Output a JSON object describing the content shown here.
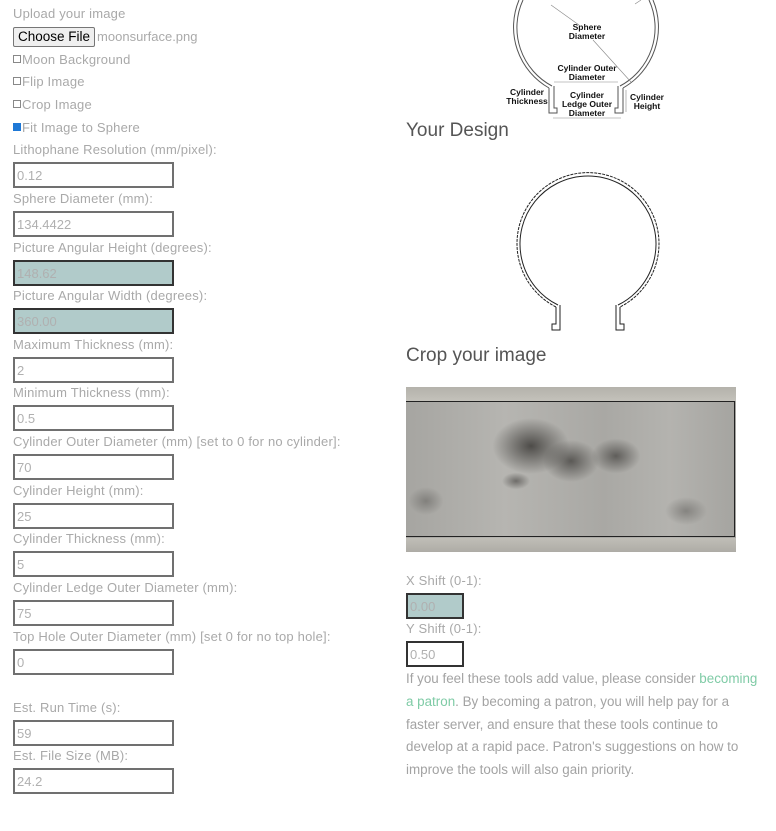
{
  "upload": {
    "label": "Upload your image",
    "button_label": "Choose File",
    "file_name": "moonsurface.png"
  },
  "options": [
    {
      "label": "Moon Background",
      "checked": false
    },
    {
      "label": "Flip Image",
      "checked": false
    },
    {
      "label": "Crop Image",
      "checked": false
    },
    {
      "label": "Fit Image to Sphere",
      "checked": true
    }
  ],
  "fields": [
    {
      "label": "Lithophane Resolution (mm/pixel):",
      "value": "0.12",
      "readonly": false
    },
    {
      "label": "Sphere Diameter (mm):",
      "value": "134.4422",
      "readonly": false
    },
    {
      "label": "Picture Angular Height (degrees):",
      "value": "148.62",
      "readonly": true
    },
    {
      "label": "Picture Angular Width (degrees):",
      "value": "360.00",
      "readonly": true
    },
    {
      "label": "Maximum Thickness (mm):",
      "value": "2",
      "readonly": false
    },
    {
      "label": "Minimum Thickness (mm):",
      "value": "0.5",
      "readonly": false
    },
    {
      "label": "Cylinder Outer Diameter (mm) [set to 0 for no cylinder]:",
      "value": "70",
      "readonly": false
    },
    {
      "label": "Cylinder Height (mm):",
      "value": "25",
      "readonly": false
    },
    {
      "label": "Cylinder Thickness (mm):",
      "value": "5",
      "readonly": false
    },
    {
      "label": "Cylinder Ledge Outer Diameter (mm):",
      "value": "75",
      "readonly": false
    },
    {
      "label": "Top Hole Outer Diameter (mm) [set 0 for no top hole]:",
      "value": "0",
      "readonly": false
    }
  ],
  "estimates": [
    {
      "label": "Est. Run Time (s):",
      "value": "59"
    },
    {
      "label": "Est. File Size (MB):",
      "value": "24.2"
    }
  ],
  "diagram": {
    "labels": {
      "sphere_diameter": [
        "Sphere",
        "Diameter"
      ],
      "cylinder_outer_diameter": [
        "Cylinder Outer",
        "Diameter"
      ],
      "cylinder_thickness": [
        "Cylinder",
        "Thickness"
      ],
      "cylinder_ledge": [
        "Cylinder",
        "Ledge Outer",
        "Diameter"
      ],
      "cylinder_height": [
        "Cylinder",
        "Height"
      ]
    }
  },
  "design": {
    "title": "Your Design"
  },
  "crop": {
    "title": "Crop your image",
    "x_shift_label": "X Shift (0-1):",
    "x_shift_value": "0.00",
    "y_shift_label": "Y Shift (0-1):",
    "y_shift_value": "0.50"
  },
  "patron": {
    "before": "If you feel these tools add value, please consider ",
    "link": "becoming a patron",
    "after": ". By becoming a patron, you will help pay for a faster server, and ensure that these tools continue to develop at a rapid pace. Patron's suggestions on how to improve the tools will also gain priority."
  },
  "colors": {
    "readonly_bg": "#b1cbca",
    "link": "#7fcba6",
    "heading": "#555555",
    "label": "#a9a9a9"
  }
}
